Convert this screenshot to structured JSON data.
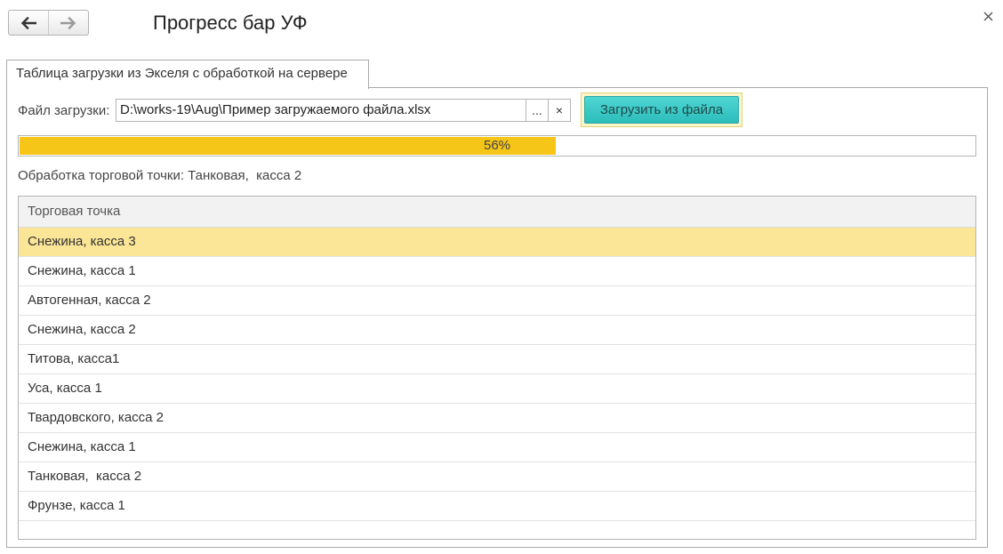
{
  "header": {
    "title": "Прогресс бар УФ",
    "back_icon": "arrow-left-icon",
    "forward_icon": "arrow-right-icon",
    "close_icon": "close-icon"
  },
  "tab": {
    "label": "Таблица загрузки из Экселя с обработкой на сервере"
  },
  "file": {
    "label": "Файл загрузки:",
    "value": "D:\\works-19\\Aug\\Пример загружаемого файла.xlsx",
    "browse_label": "...",
    "clear_label": "×"
  },
  "load_button": {
    "label": "Загрузить из файла"
  },
  "progress": {
    "value": 56,
    "text": "56%"
  },
  "status_text": "Обработка торговой точки: Танковая,  касса 2",
  "table": {
    "header": "Торговая точка",
    "selected_index": 0,
    "rows": [
      "Снежина, касса 3",
      "Снежина, касса 1",
      "Автогенная, касса 2",
      "Снежина, касса 2",
      "Титова, касса1",
      "Уса, касса 1",
      "Твардовского, касса 2",
      "Снежина, касса 1",
      "Танковая,  касса 2",
      "Фрунзе, касса 1"
    ]
  },
  "colors": {
    "progress_fill": "#f5c518",
    "selected_row": "#fbe596",
    "load_button": "#2cbdbb"
  }
}
